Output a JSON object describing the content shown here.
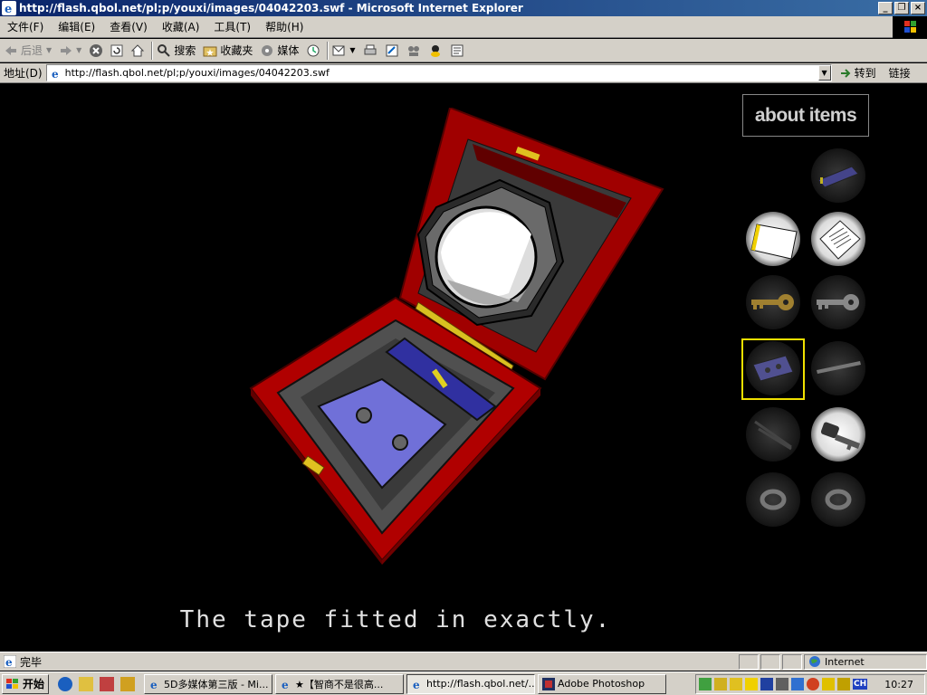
{
  "window": {
    "title": "http://flash.qbol.net/pl;p/youxi/images/04042203.swf - Microsoft Internet Explorer",
    "min": "_",
    "max": "❐",
    "close": "×"
  },
  "menu": [
    "文件(F)",
    "编辑(E)",
    "查看(V)",
    "收藏(A)",
    "工具(T)",
    "帮助(H)"
  ],
  "toolbar": {
    "back": "后退",
    "search": "搜索",
    "favorites": "收藏夹",
    "media": "媒体"
  },
  "address": {
    "label": "地址(D)",
    "url": "http://flash.qbol.net/pl;p/youxi/images/04042203.swf",
    "goto": "转到",
    "links": "链接"
  },
  "game": {
    "about_label": "about items",
    "caption": "The tape fitted in exactly.",
    "inventory": [
      {
        "name": "tape",
        "state": "dim"
      },
      {
        "name": "note-card",
        "state": "lit"
      },
      {
        "name": "letter",
        "state": "lit"
      },
      {
        "name": "gold-key",
        "state": "dim"
      },
      {
        "name": "silver-key",
        "state": "dim"
      },
      {
        "name": "cassette",
        "state": "selected"
      },
      {
        "name": "rod",
        "state": "dim"
      },
      {
        "name": "tweezers",
        "state": "dim"
      },
      {
        "name": "car-key",
        "state": "lit"
      },
      {
        "name": "ring-1",
        "state": "dim"
      },
      {
        "name": "ring-2",
        "state": "dim"
      }
    ]
  },
  "status": {
    "text": "完毕",
    "zone": "Internet"
  },
  "taskbar": {
    "start": "开始",
    "tasks": [
      {
        "label": "5D多媒体第三版 - Mi..."
      },
      {
        "label": "★【智商不是很高..."
      },
      {
        "label": "http://flash.qbol.net/..."
      },
      {
        "label": "Adobe Photoshop"
      }
    ],
    "tray_lang": "CH",
    "clock": "10:27"
  },
  "colors": {
    "titlebar": "#0a246a",
    "chrome": "#d4d0c8",
    "box_red": "#b00000",
    "selection": "#f0e000"
  }
}
